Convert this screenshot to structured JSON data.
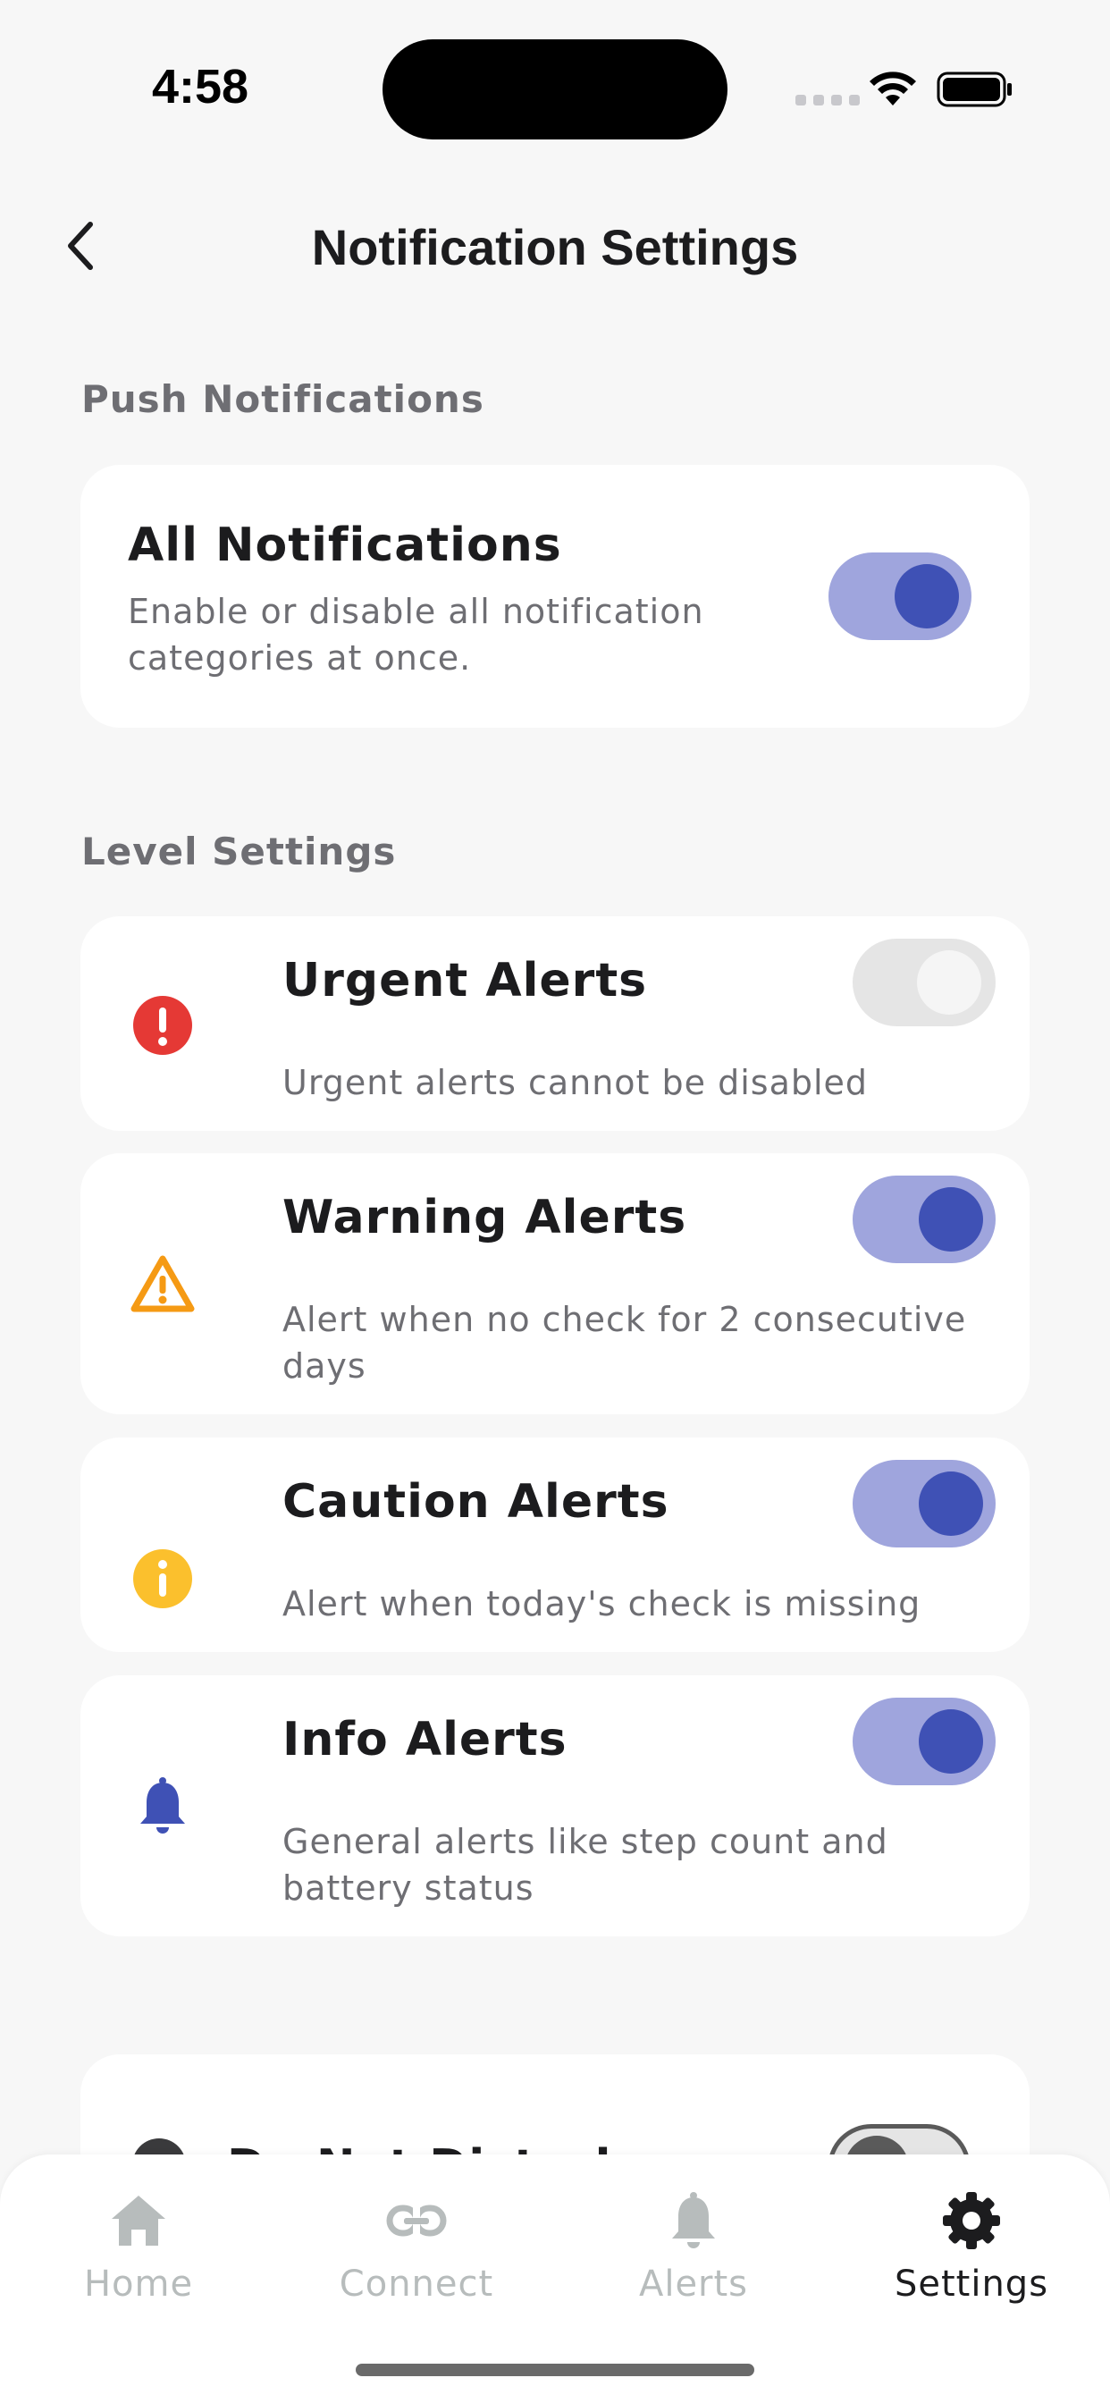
{
  "status_bar": {
    "time": "4:58",
    "icons": [
      "signal-icon",
      "wifi-icon",
      "battery-icon"
    ]
  },
  "header": {
    "title": "Notification Settings",
    "back_icon": "chevron-left-icon"
  },
  "push_section": {
    "label": "Push Notifications",
    "all": {
      "title": "All Notifications",
      "description_line1": "Enable or disable all notification",
      "description_line2": "categories at once.",
      "enabled": true
    }
  },
  "level_section": {
    "label": "Level Settings",
    "items": [
      {
        "title": "Urgent Alerts",
        "description_line1": "Urgent alerts cannot be disabled",
        "description_line2": "",
        "icon": "exclamation-circle-icon",
        "icon_color": "#e53935",
        "enabled": false
      },
      {
        "title": "Warning Alerts",
        "description_line1": "Alert when no check for 2 consecutive",
        "description_line2": "days",
        "icon": "warning-triangle-icon",
        "icon_color": "#f59a14",
        "enabled": true
      },
      {
        "title": "Caution Alerts",
        "description_line1": "Alert when today's check is missing",
        "description_line2": "",
        "icon": "info-circle-icon",
        "icon_color": "#fbc02d",
        "enabled": true
      },
      {
        "title": "Info Alerts",
        "description_line1": "General alerts like step count and",
        "description_line2": "battery status",
        "icon": "bell-icon",
        "icon_color": "#3f51b5",
        "enabled": true
      }
    ]
  },
  "dnd": {
    "title": "Do Not Disturb",
    "enabled": false
  },
  "tab_bar": {
    "items": [
      {
        "label": "Home",
        "icon": "home-icon",
        "active": false
      },
      {
        "label": "Connect",
        "icon": "link-icon",
        "active": false
      },
      {
        "label": "Alerts",
        "icon": "bell-icon",
        "active": false
      },
      {
        "label": "Settings",
        "icon": "gear-icon",
        "active": true
      }
    ]
  },
  "colors": {
    "accent": "#3f51b5",
    "toggle_track_on": "#9fa5dd",
    "toggle_track_off": "#e5e5e5",
    "background": "#f7f7f7",
    "card": "#ffffff"
  }
}
